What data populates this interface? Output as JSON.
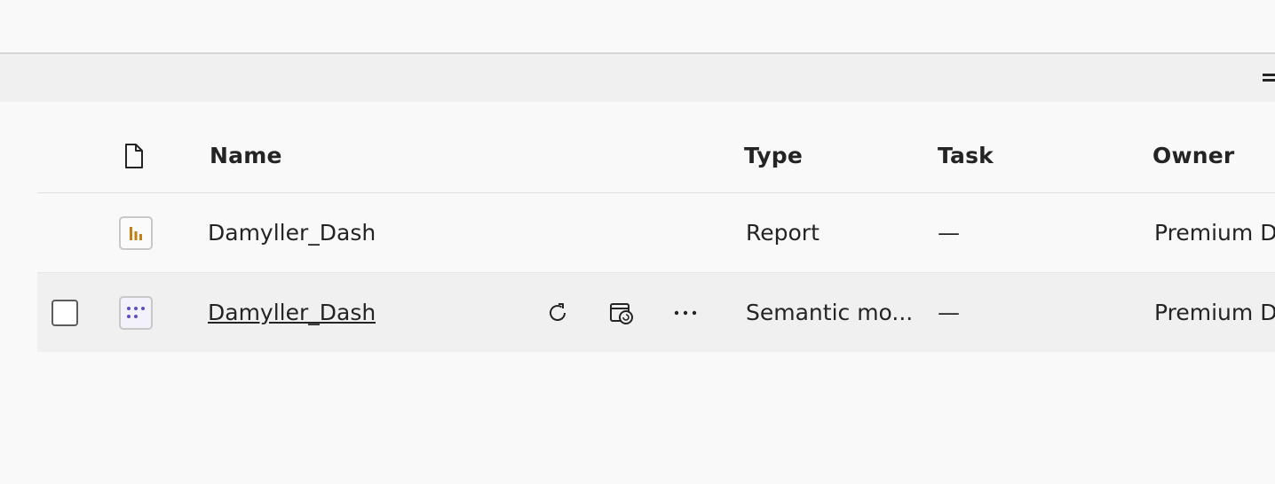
{
  "table": {
    "columns": {
      "name": "Name",
      "type": "Type",
      "task": "Task",
      "owner": "Owner"
    },
    "rows": [
      {
        "name": "Damyller_Dash",
        "type": "Report",
        "task": "—",
        "owner": "Premium D",
        "icon": "report-icon"
      },
      {
        "name": "Damyller_Dash",
        "type": "Semantic mo...",
        "task": "—",
        "owner": "Premium D",
        "icon": "semantic-model-icon"
      }
    ]
  },
  "colors": {
    "report_accent": "#c47f16",
    "semantic_accent": "#5b4ec4",
    "text": "#242424"
  }
}
